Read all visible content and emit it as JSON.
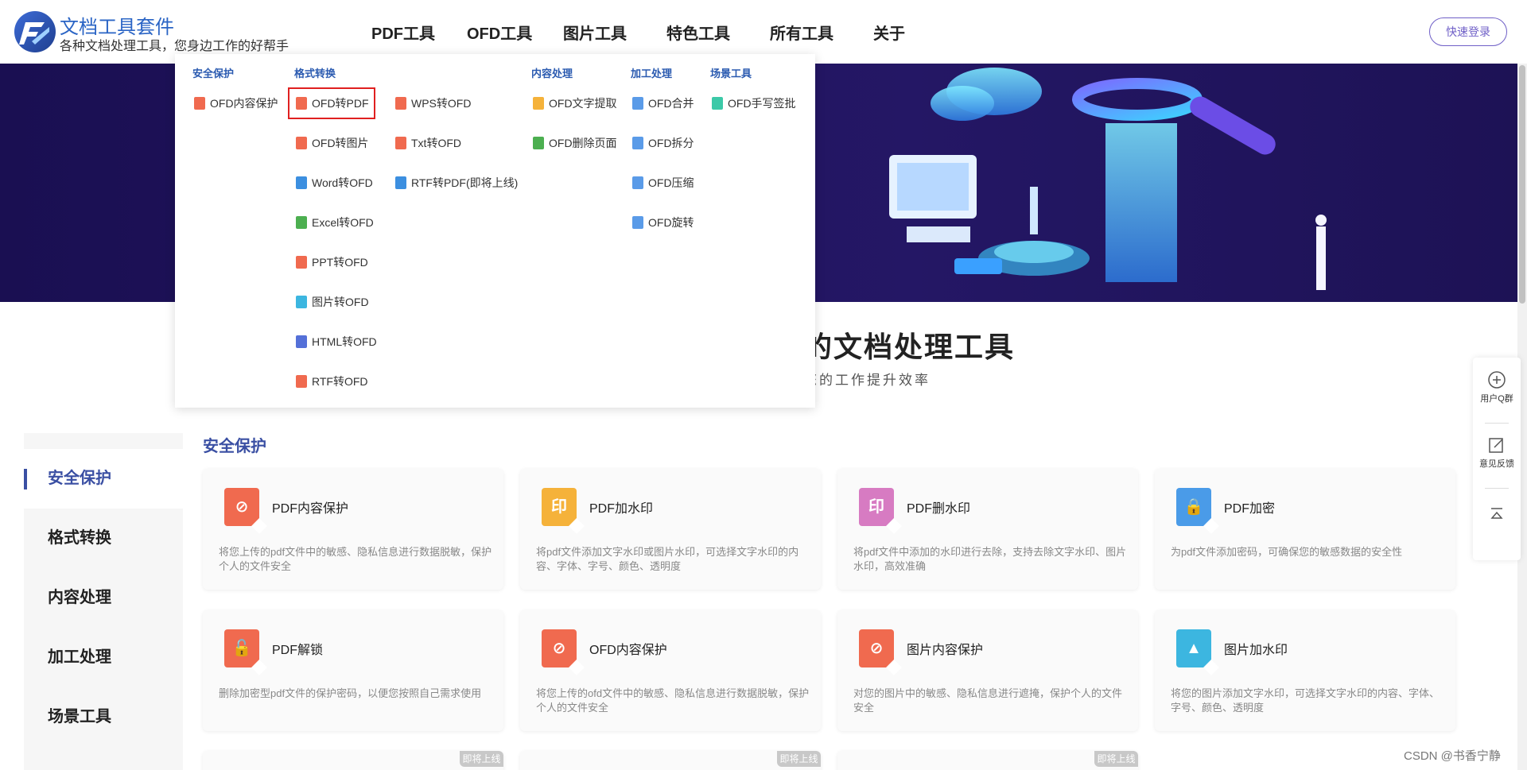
{
  "header": {
    "logo_title": "文档工具套件",
    "logo_subtitle": "各种文档处理工具，您身边工作的好帮手",
    "nav": [
      "PDF工具",
      "OFD工具",
      "图片工具",
      "特色工具",
      "所有工具",
      "关于"
    ],
    "login_label": "快速登录"
  },
  "dropdown": {
    "columns": [
      {
        "heading": "安全保护",
        "items": [
          "OFD内容保护"
        ]
      },
      {
        "heading": "格式转换",
        "items": [
          "OFD转PDF",
          "OFD转图片",
          "Word转OFD",
          "Excel转OFD",
          "PPT转OFD",
          "图片转OFD",
          "HTML转OFD",
          "RTF转OFD"
        ]
      },
      {
        "heading": "",
        "items": [
          "WPS转OFD",
          "Txt转OFD",
          "RTF转PDF(即将上线)"
        ]
      },
      {
        "heading": "内容处理",
        "items": [
          "OFD文字提取",
          "OFD删除页面"
        ]
      },
      {
        "heading": "加工处理",
        "items": [
          "OFD合并",
          "OFD拆分",
          "OFD压缩",
          "OFD旋转"
        ]
      },
      {
        "heading": "场景工具",
        "items": [
          "OFD手写签批"
        ]
      }
    ],
    "selected": "OFD转PDF"
  },
  "main": {
    "title": "的文档处理工具",
    "subtitle": "您的工作提升效率"
  },
  "sidebar": {
    "items": [
      "安全保护",
      "格式转换",
      "内容处理",
      "加工处理",
      "场景工具"
    ],
    "active": "安全保护"
  },
  "section": {
    "title": "安全保护",
    "cards": [
      {
        "title": "PDF内容保护",
        "desc": "将您上传的pdf文件中的敏感、隐私信息进行数据脱敏，保护个人的文件安全",
        "color": "#f06a4f",
        "glyph": "⊘"
      },
      {
        "title": "PDF加水印",
        "desc": "将pdf文件添加文字水印或图片水印，可选择文字水印的内容、字体、字号、颜色、透明度",
        "color": "#f5b23a",
        "glyph": "印"
      },
      {
        "title": "PDF删水印",
        "desc": "将pdf文件中添加的水印进行去除，支持去除文字水印、图片水印，高效准确",
        "color": "#d77bc2",
        "glyph": "印"
      },
      {
        "title": "PDF加密",
        "desc": "为pdf文件添加密码，可确保您的敏感数据的安全性",
        "color": "#4a9be8",
        "glyph": "🔒"
      },
      {
        "title": "PDF解锁",
        "desc": "删除加密型pdf文件的保护密码，以便您按照自己需求使用",
        "color": "#f06a4f",
        "glyph": "🔓"
      },
      {
        "title": "OFD内容保护",
        "desc": "将您上传的ofd文件中的敏感、隐私信息进行数据脱敏，保护个人的文件安全",
        "color": "#f06a4f",
        "glyph": "⊘"
      },
      {
        "title": "图片内容保护",
        "desc": "对您的图片中的敏感、隐私信息进行遮掩，保护个人的文件安全",
        "color": "#f06a4f",
        "glyph": "⊘"
      },
      {
        "title": "图片加水印",
        "desc": "将您的图片添加文字水印，可选择文字水印的内容、字体、字号、颜色、透明度",
        "color": "#3cb6e0",
        "glyph": "▲"
      }
    ],
    "coming_soon": "即将上线"
  },
  "float_bar": {
    "qq_label": "用户Q群",
    "feedback_label": "意见反馈"
  },
  "watermark": "CSDN @书香宁静"
}
